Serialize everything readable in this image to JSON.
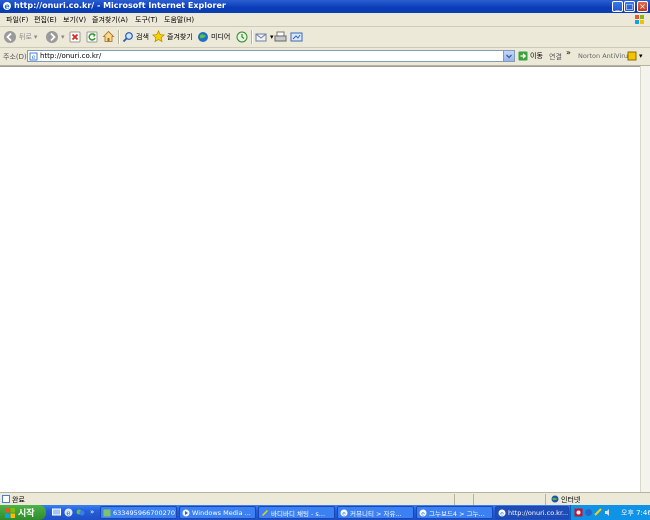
{
  "window": {
    "title": "http://onuri.co.kr/ - Microsoft Internet Explorer",
    "controls": [
      "_",
      "□",
      "×"
    ]
  },
  "menu": [
    "파일(F)",
    "편집(E)",
    "보기(V)",
    "즐겨찾기(A)",
    "도구(T)",
    "도움말(H)"
  ],
  "toolbar": {
    "back": "뒤로",
    "search": "검색",
    "favorites": "즐겨찾기",
    "media": "미디어"
  },
  "address": {
    "label": "주소(D)",
    "value": "http://onuri.co.kr/",
    "go": "이동",
    "links": "연결",
    "addon": "Norton AntiVirus"
  },
  "status": {
    "text": "완료",
    "zone": "인터넷"
  },
  "taskbar": {
    "start": "시작",
    "tasks": [
      "6334959667002707...",
      "Windows Media ...",
      "바디바디 채팅 - s...",
      "커뮤니티 > 자유...",
      "그누보드4 > 그누...",
      "http://onuri.co.kr..."
    ],
    "clock": "오후 7:46"
  }
}
